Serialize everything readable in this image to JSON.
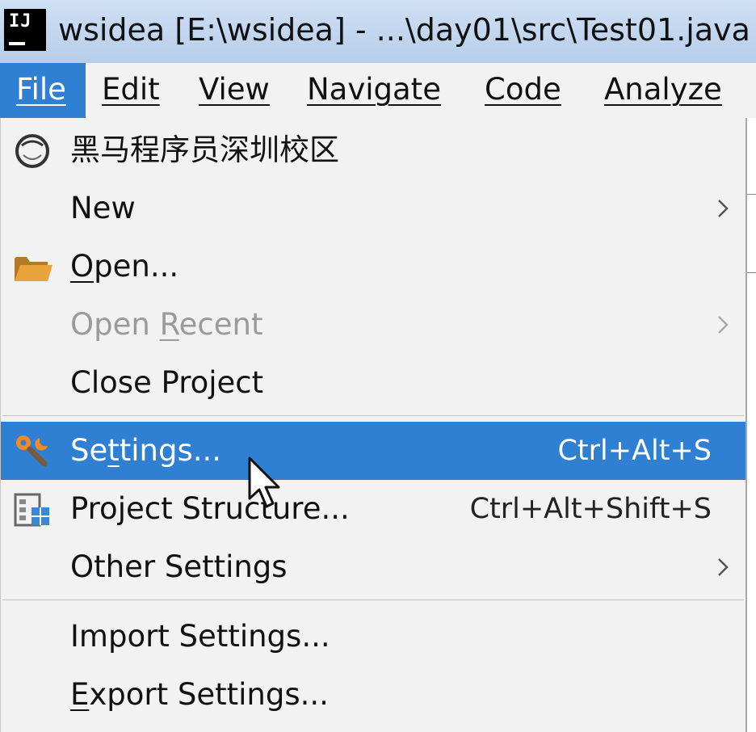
{
  "window": {
    "logo_text": "IJ",
    "title": "wsidea [E:\\wsidea] - ...\\day01\\src\\Test01.java"
  },
  "menubar": {
    "items": [
      {
        "label": "File",
        "active": true
      },
      {
        "label": "Edit"
      },
      {
        "label": "View"
      },
      {
        "label": "Navigate"
      },
      {
        "label": "Code"
      },
      {
        "label": "Analyze"
      }
    ]
  },
  "file_menu": {
    "items": [
      {
        "label": "黑马程序员深圳校区",
        "icon": "circle-logo-icon"
      },
      {
        "label": "New",
        "submenu": true
      },
      {
        "label": "Open...",
        "icon": "folder-icon"
      },
      {
        "label": "Open Recent",
        "submenu": true,
        "disabled": true
      },
      {
        "label": "Close Project"
      },
      {
        "label": "Settings...",
        "shortcut": "Ctrl+Alt+S",
        "icon": "settings-wrench-icon",
        "highlighted": true
      },
      {
        "label": "Project Structure...",
        "shortcut": "Ctrl+Alt+Shift+S",
        "icon": "project-structure-icon"
      },
      {
        "label": "Other Settings",
        "submenu": true
      },
      {
        "label": "Import Settings..."
      },
      {
        "label": "Export Settings..."
      }
    ]
  },
  "colors": {
    "highlight": "#2f7fd3",
    "menu_background": "#f2f2f2",
    "disabled_text": "#9a9a9a",
    "folder": "#e8a33a"
  }
}
